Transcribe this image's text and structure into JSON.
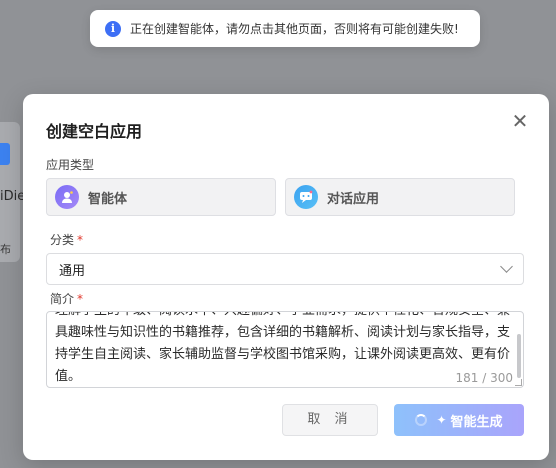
{
  "toast": {
    "message": "正在创建智能体，请勿点击其他页面，否则将有可能创建失败!"
  },
  "background": {
    "card_text": "iDie",
    "card_sub": "布"
  },
  "modal": {
    "title": "创建空白应用",
    "type_label": "应用类型",
    "types": [
      {
        "label": "智能体",
        "icon": "agent-icon"
      },
      {
        "label": "对话应用",
        "icon": "chat-icon"
      }
    ],
    "category_label": "分类",
    "category_value": "通用",
    "intro_label": "简介",
    "intro_text": "理解学生的年级、阅读水平、兴趣偏好、学业需求，提供个性化、合规安全、兼具趣味性与知识性的书籍推荐，包含详细的书籍解析、阅读计划与家长指导，支持学生自主阅读、家长辅助监督与学校图书馆采购，让课外阅读更高效、更有价值。",
    "intro_counter": "181 / 300",
    "cancel_label": "取 消",
    "generate_label": "智能生成"
  },
  "colors": {
    "accent_blue": "#3d6ff5",
    "required": "#e0362b"
  }
}
